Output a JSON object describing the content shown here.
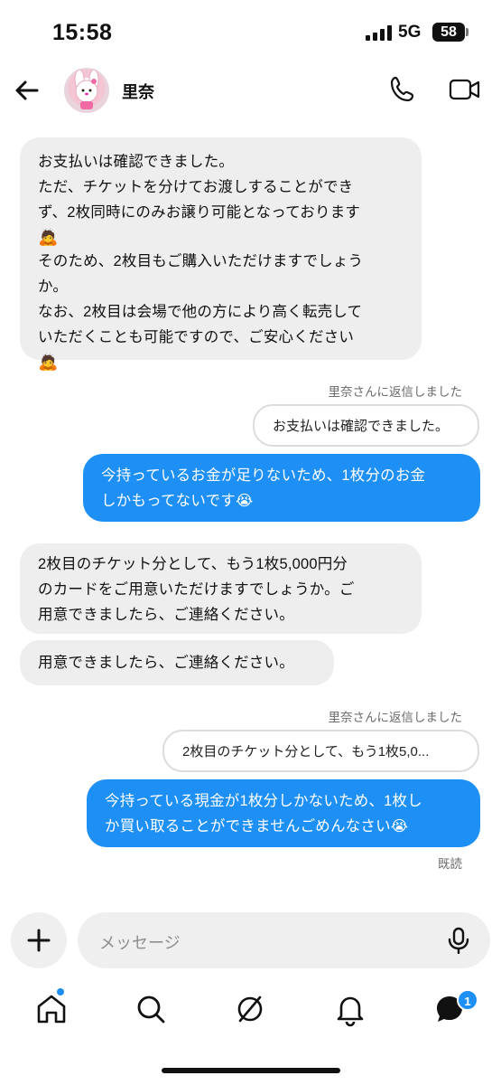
{
  "status_bar": {
    "time": "15:58",
    "network": "5G",
    "battery": "58"
  },
  "header": {
    "contact_name": "里奈"
  },
  "messages": [
    {
      "lines": [
        "お支払いは確認できました。",
        "ただ、チケットを分けてお渡しすることができ",
        "ず、2枚同時にのみお譲り可能となっております",
        "🙇",
        "そのため、2枚目もご購入いただけますでしょう",
        "か。",
        "なお、2枚目は会場で他の方により高く転売して",
        "いただくことも可能ですので、ご安心ください",
        "🙇"
      ]
    },
    {
      "reply_label": "里奈さんに返信しました",
      "quote": "お支払いは確認できました。"
    },
    {
      "lines": [
        "今持っているお金が足りないため、1枚分のお金",
        "しかもってないです😭"
      ]
    },
    {
      "lines": [
        "2枚目のチケット分として、もう1枚5,000円分",
        "のカードをご用意いただけますでしょうか。ご",
        "用意できましたら、ご連絡ください。"
      ]
    },
    {
      "lines": [
        "用意できましたら、ご連絡ください。"
      ]
    },
    {
      "reply_label": "里奈さんに返信しました",
      "quote": "2枚目のチケット分として、もう1枚5,0..."
    },
    {
      "lines": [
        "今持っている現金が1枚分しかないため、1枚し",
        "か買い取ることができませんごめんなさい😭"
      ]
    }
  ],
  "read_receipt": "既読",
  "composer": {
    "placeholder": "メッセージ"
  },
  "nav": {
    "messages_badge": "1"
  },
  "colors": {
    "accent": "#1d8ff5",
    "incoming_bubble": "#eeeeef"
  },
  "icons": [
    "back-arrow-icon",
    "phone-icon",
    "video-icon",
    "plus-icon",
    "microphone-icon",
    "home-icon",
    "search-icon",
    "explore-icon",
    "bell-icon",
    "messages-icon"
  ]
}
